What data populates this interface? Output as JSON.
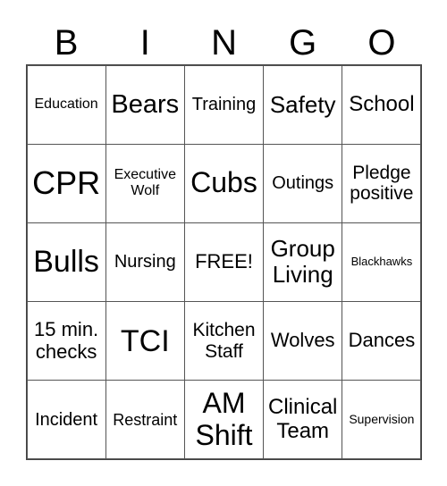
{
  "header": [
    "B",
    "I",
    "N",
    "G",
    "O"
  ],
  "cells": [
    "Education",
    "Bears",
    "Training",
    "Safety",
    "School",
    "CPR",
    "Executive Wolf",
    "Cubs",
    "Outings",
    "Pledge positive",
    "Bulls",
    "Nursing",
    "FREE!",
    "Group Living",
    "Blackhawks",
    "15 min. checks",
    "TCI",
    "Kitchen Staff",
    "Wolves",
    "Dances",
    "Incident",
    "Restraint",
    "AM Shift",
    "Clinical Team",
    "Supervision"
  ]
}
